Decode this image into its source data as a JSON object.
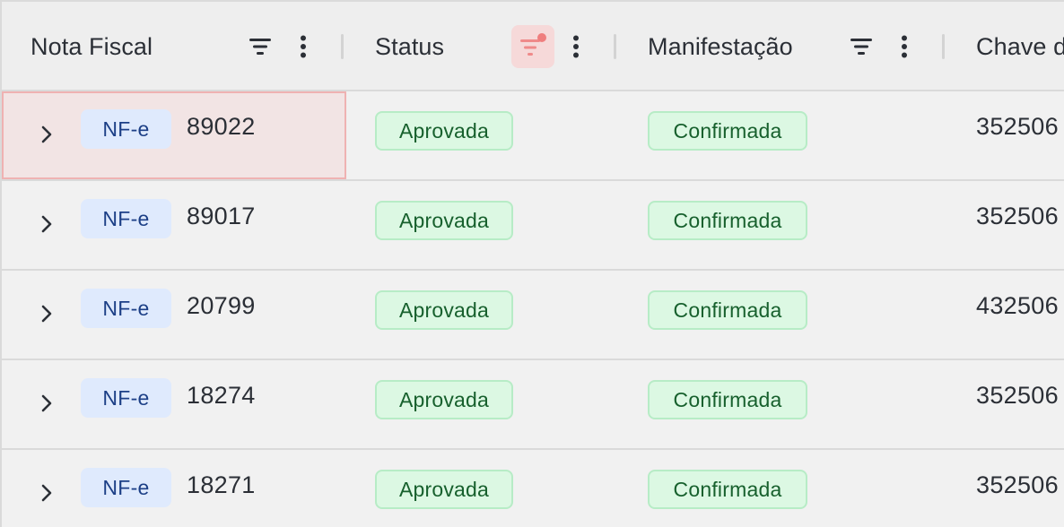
{
  "columns": {
    "nota_fiscal": {
      "label": "Nota Fiscal",
      "filter_icon": "filter-lines-icon",
      "menu_icon": "kebab-menu-icon"
    },
    "status": {
      "label": "Status",
      "filter_icon": "filter-active-icon",
      "filter_active": true,
      "menu_icon": "kebab-menu-icon"
    },
    "manifestacao": {
      "label": "Manifestação",
      "filter_icon": "filter-lines-icon",
      "menu_icon": "kebab-menu-icon"
    },
    "chave": {
      "label": "Chave d"
    }
  },
  "rows": [
    {
      "doc_type": "NF-e",
      "number": "89022",
      "status": "Aprovada",
      "manifestacao": "Confirmada",
      "chave": "352506",
      "focused": true
    },
    {
      "doc_type": "NF-e",
      "number": "89017",
      "status": "Aprovada",
      "manifestacao": "Confirmada",
      "chave": "352506"
    },
    {
      "doc_type": "NF-e",
      "number": "20799",
      "status": "Aprovada",
      "manifestacao": "Confirmada",
      "chave": "432506"
    },
    {
      "doc_type": "NF-e",
      "number": "18274",
      "status": "Aprovada",
      "manifestacao": "Confirmada",
      "chave": "352506"
    },
    {
      "doc_type": "NF-e",
      "number": "18271",
      "status": "Aprovada",
      "manifestacao": "Confirmada",
      "chave": "352506"
    }
  ],
  "colors": {
    "chip_bg": "#dfeafd",
    "chip_text": "#1c3f86",
    "pill_bg": "#dcf8e3",
    "pill_text": "#17602d",
    "filter_active_accent": "#ef8a8a",
    "focus_border": "#efb2b2"
  }
}
